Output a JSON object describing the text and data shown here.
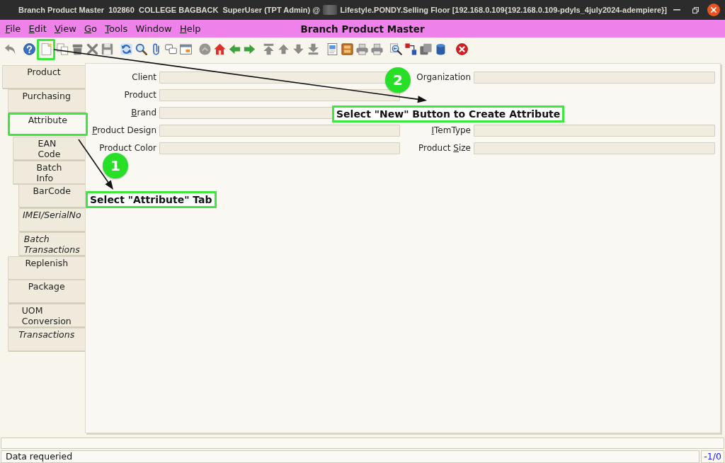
{
  "window": {
    "title_parts": [
      {
        "kind": "text",
        "text": "Branch Product Master  102860  COLLEGE BAGBACK  SuperUser (TPT Admin) @"
      },
      {
        "kind": "redacted"
      },
      {
        "kind": "text",
        "text": "Lifestyle.PONDY.Selling Floor [192.168.0.109{192.168.0.109-pdyls_4july2024-adempiere}]"
      }
    ]
  },
  "menu_bar": {
    "items": [
      {
        "label": "File",
        "mnemonic": true
      },
      {
        "label": "Edit",
        "mnemonic": true
      },
      {
        "label": "View",
        "mnemonic": true
      },
      {
        "label": "Go",
        "mnemonic": true
      },
      {
        "label": "Tools",
        "mnemonic": true
      },
      {
        "label": "Window",
        "mnemonic": false
      },
      {
        "label": "Help",
        "mnemonic": true
      }
    ],
    "title": "Branch Product Master"
  },
  "toolbar": {
    "groups": [
      {
        "buttons": [
          {
            "kind": "undo",
            "disabled": true,
            "highlighted": false
          }
        ]
      },
      {
        "buttons": [
          {
            "kind": "help",
            "disabled": false,
            "highlighted": false
          },
          {
            "kind": "new",
            "disabled": false,
            "highlighted": true
          },
          {
            "kind": "copy",
            "disabled": true,
            "highlighted": false
          },
          {
            "kind": "delete",
            "disabled": true,
            "highlighted": false
          },
          {
            "kind": "delete_selection",
            "disabled": true,
            "highlighted": false
          },
          {
            "kind": "save",
            "disabled": true,
            "highlighted": false
          }
        ]
      },
      {
        "buttons": [
          {
            "kind": "refresh",
            "disabled": false,
            "highlighted": false
          },
          {
            "kind": "find",
            "disabled": false,
            "highlighted": false
          },
          {
            "kind": "attach",
            "disabled": false,
            "highlighted": false
          },
          {
            "kind": "chat",
            "disabled": false,
            "highlighted": false
          },
          {
            "kind": "history",
            "disabled": false,
            "highlighted": false
          }
        ]
      },
      {
        "buttons": [
          {
            "kind": "parent",
            "disabled": true,
            "highlighted": false
          },
          {
            "kind": "home",
            "disabled": false,
            "highlighted": false
          },
          {
            "kind": "back",
            "disabled": false,
            "highlighted": false
          },
          {
            "kind": "forward",
            "disabled": false,
            "highlighted": false
          }
        ]
      },
      {
        "buttons": [
          {
            "kind": "first",
            "disabled": true,
            "highlighted": false
          },
          {
            "kind": "previous",
            "disabled": true,
            "highlighted": false
          },
          {
            "kind": "next",
            "disabled": true,
            "highlighted": false
          },
          {
            "kind": "last",
            "disabled": true,
            "highlighted": false
          }
        ]
      },
      {
        "buttons": [
          {
            "kind": "report",
            "disabled": false,
            "highlighted": false
          },
          {
            "kind": "archive",
            "disabled": false,
            "highlighted": false
          },
          {
            "kind": "print_preview",
            "disabled": false,
            "highlighted": false
          },
          {
            "kind": "print",
            "disabled": false,
            "highlighted": false
          }
        ]
      },
      {
        "buttons": [
          {
            "kind": "zoom_across",
            "disabled": false,
            "highlighted": false
          },
          {
            "kind": "workflow",
            "disabled": false,
            "highlighted": false
          },
          {
            "kind": "request",
            "disabled": false,
            "highlighted": false
          },
          {
            "kind": "product_info",
            "disabled": false,
            "highlighted": false
          }
        ]
      },
      {
        "buttons": [
          {
            "kind": "close",
            "disabled": false,
            "highlighted": false
          }
        ]
      }
    ]
  },
  "tabs": [
    {
      "label": "Product",
      "selected": false,
      "read_only": false,
      "highlighted": false,
      "children": [
        {
          "label": "Purchasing",
          "selected": false,
          "read_only": false,
          "highlighted": false
        },
        {
          "label": "Attribute",
          "selected": true,
          "read_only": false,
          "highlighted": true,
          "children": [
            {
              "label": "EAN\nCode",
              "selected": false,
              "read_only": false,
              "highlighted": false
            },
            {
              "label": "Batch\nInfo",
              "selected": false,
              "read_only": false,
              "highlighted": false,
              "children": [
                {
                  "label": "BarCode",
                  "selected": false,
                  "read_only": false,
                  "highlighted": false
                },
                {
                  "label": "IMEI/SerialNo",
                  "selected": false,
                  "read_only": true,
                  "highlighted": false
                },
                {
                  "label": "Batch\nTransactions",
                  "selected": false,
                  "read_only": true,
                  "highlighted": false
                }
              ]
            }
          ]
        },
        {
          "label": "Replenish",
          "selected": false,
          "read_only": false,
          "highlighted": false
        },
        {
          "label": "Package",
          "selected": false,
          "read_only": false,
          "highlighted": false
        },
        {
          "label": "UOM\nConversion",
          "selected": false,
          "read_only": false,
          "highlighted": false
        },
        {
          "label": "Transactions",
          "selected": false,
          "read_only": true,
          "highlighted": false
        }
      ]
    }
  ],
  "form": {
    "rows": [
      {
        "fields": [
          {
            "label": "Client",
            "mnemonic": false
          },
          {
            "label": "Organization",
            "mnemonic": false
          }
        ]
      },
      {
        "fields": [
          {
            "label": "Product",
            "mnemonic": false
          }
        ]
      },
      {
        "fields": [
          {
            "label": "Brand",
            "mnemonic": true
          }
        ]
      },
      {
        "fields": [
          {
            "label": "Product Design",
            "mnemonic": true,
            "mnemonic_on_last_word": false
          },
          {
            "label": "ITemType",
            "mnemonic": true
          }
        ]
      },
      {
        "fields": [
          {
            "label": "Product Color",
            "mnemonic": false
          },
          {
            "label": "Product Size",
            "mnemonic": true,
            "mnemonic_on_last_word": true
          }
        ]
      }
    ]
  },
  "annotations": [
    {
      "number": "1",
      "text": "Select \"Attribute\" Tab"
    },
    {
      "number": "2",
      "text": "Select \"New\" Button to Create Attribute"
    }
  ],
  "status_bar": {
    "message": "Data requeried",
    "record": "-1/0"
  }
}
